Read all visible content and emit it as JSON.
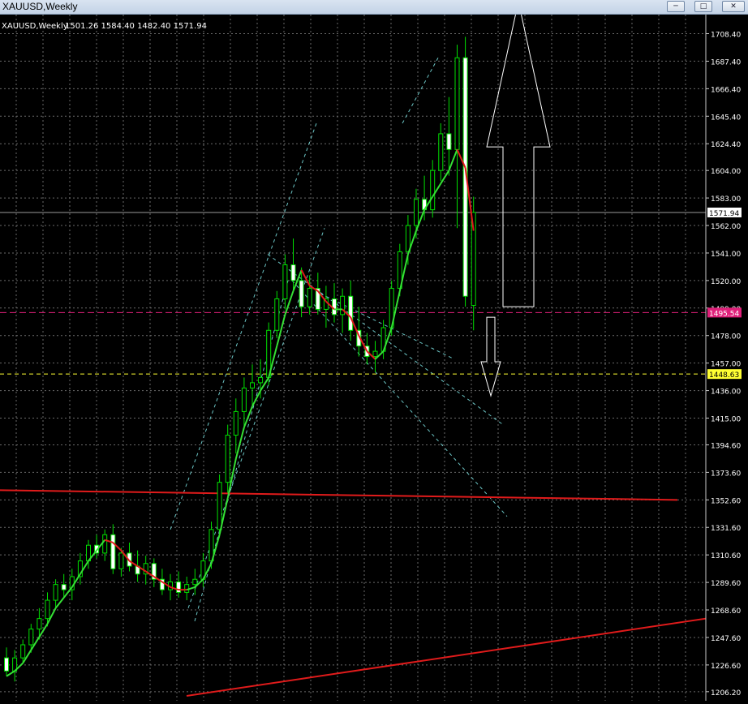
{
  "window": {
    "title": "XAUUSD,Weekly",
    "buttons": {
      "minimize": "min",
      "maximize": "max",
      "close": "close"
    }
  },
  "chart_header": {
    "symbol": "XAUUSD,Weekly",
    "ohlc": "1501.26 1584.40 1482.40 1571.94"
  },
  "colors": {
    "background": "#000000",
    "grid": "#6a6a6a",
    "bull": "#00e000",
    "ma_up": "#35e035",
    "ma_down": "#e01b1b",
    "trendline": "#e01b1b",
    "channel": "#6cc6c6",
    "resistance": "#e0207a",
    "support": "#ffff33"
  },
  "chart_data": {
    "type": "candlestick",
    "price_axis": [
      "1708.40",
      "1687.40",
      "1666.40",
      "1645.40",
      "1624.40",
      "1604.00",
      "1583.00",
      "1562.00",
      "1541.00",
      "1520.00",
      "1499.00",
      "1478.00",
      "1457.00",
      "1436.00",
      "1415.00",
      "1394.60",
      "1373.60",
      "1352.60",
      "1331.60",
      "1310.60",
      "1289.60",
      "1268.60",
      "1247.60",
      "1226.60",
      "1206.20"
    ],
    "ylim": [
      1203,
      1718
    ],
    "current_price_label": "1571.94",
    "resistance_label": "1495.54",
    "support_label": "1448.63",
    "candles": [
      [
        1232,
        1240,
        1218,
        1222
      ],
      [
        1222,
        1238,
        1214,
        1232
      ],
      [
        1232,
        1246,
        1228,
        1242
      ],
      [
        1242,
        1258,
        1236,
        1254
      ],
      [
        1254,
        1270,
        1246,
        1262
      ],
      [
        1262,
        1282,
        1256,
        1276
      ],
      [
        1276,
        1292,
        1270,
        1288
      ],
      [
        1288,
        1296,
        1278,
        1284
      ],
      [
        1284,
        1300,
        1276,
        1294
      ],
      [
        1294,
        1312,
        1288,
        1306
      ],
      [
        1306,
        1322,
        1300,
        1318
      ],
      [
        1318,
        1326,
        1308,
        1312
      ],
      [
        1312,
        1330,
        1306,
        1326
      ],
      [
        1326,
        1334,
        1296,
        1300
      ],
      [
        1300,
        1316,
        1294,
        1312
      ],
      [
        1312,
        1320,
        1298,
        1302
      ],
      [
        1302,
        1314,
        1290,
        1296
      ],
      [
        1296,
        1310,
        1288,
        1304
      ],
      [
        1304,
        1308,
        1286,
        1292
      ],
      [
        1292,
        1300,
        1280,
        1284
      ],
      [
        1284,
        1296,
        1276,
        1290
      ],
      [
        1290,
        1298,
        1278,
        1282
      ],
      [
        1282,
        1294,
        1276,
        1288
      ],
      [
        1288,
        1300,
        1280,
        1292
      ],
      [
        1292,
        1312,
        1286,
        1306
      ],
      [
        1306,
        1336,
        1300,
        1330
      ],
      [
        1330,
        1372,
        1324,
        1366
      ],
      [
        1366,
        1410,
        1358,
        1402
      ],
      [
        1402,
        1430,
        1388,
        1420
      ],
      [
        1420,
        1446,
        1408,
        1438
      ],
      [
        1438,
        1456,
        1424,
        1442
      ],
      [
        1442,
        1460,
        1430,
        1446
      ],
      [
        1446,
        1488,
        1440,
        1482
      ],
      [
        1482,
        1512,
        1476,
        1506
      ],
      [
        1506,
        1540,
        1498,
        1532
      ],
      [
        1532,
        1552,
        1512,
        1520
      ],
      [
        1520,
        1530,
        1492,
        1500
      ],
      [
        1500,
        1524,
        1494,
        1514
      ],
      [
        1514,
        1526,
        1494,
        1498
      ],
      [
        1498,
        1516,
        1484,
        1506
      ],
      [
        1506,
        1518,
        1488,
        1494
      ],
      [
        1494,
        1514,
        1480,
        1508
      ],
      [
        1508,
        1520,
        1474,
        1482
      ],
      [
        1482,
        1500,
        1462,
        1470
      ],
      [
        1470,
        1480,
        1456,
        1462
      ],
      [
        1462,
        1474,
        1450,
        1466
      ],
      [
        1466,
        1490,
        1460,
        1484
      ],
      [
        1484,
        1520,
        1478,
        1514
      ],
      [
        1514,
        1548,
        1508,
        1542
      ],
      [
        1542,
        1570,
        1532,
        1562
      ],
      [
        1562,
        1590,
        1552,
        1582
      ],
      [
        1582,
        1600,
        1566,
        1574
      ],
      [
        1574,
        1612,
        1568,
        1604
      ],
      [
        1604,
        1640,
        1596,
        1632
      ],
      [
        1632,
        1660,
        1600,
        1620
      ],
      [
        1620,
        1700,
        1560,
        1690
      ],
      [
        1690,
        1706,
        1500,
        1508
      ],
      [
        1501,
        1584,
        1482,
        1572
      ]
    ],
    "ma_points": [
      [
        1218,
        "u"
      ],
      [
        1222,
        "u"
      ],
      [
        1228,
        "u"
      ],
      [
        1238,
        "u"
      ],
      [
        1248,
        "u"
      ],
      [
        1258,
        "u"
      ],
      [
        1270,
        "u"
      ],
      [
        1278,
        "u"
      ],
      [
        1286,
        "u"
      ],
      [
        1296,
        "u"
      ],
      [
        1306,
        "u"
      ],
      [
        1314,
        "u"
      ],
      [
        1322,
        "u"
      ],
      [
        1320,
        "d"
      ],
      [
        1314,
        "d"
      ],
      [
        1306,
        "d"
      ],
      [
        1302,
        "d"
      ],
      [
        1298,
        "d"
      ],
      [
        1294,
        "d"
      ],
      [
        1290,
        "d"
      ],
      [
        1286,
        "d"
      ],
      [
        1284,
        "d"
      ],
      [
        1284,
        "d"
      ],
      [
        1286,
        "u"
      ],
      [
        1292,
        "u"
      ],
      [
        1304,
        "u"
      ],
      [
        1326,
        "u"
      ],
      [
        1354,
        "u"
      ],
      [
        1384,
        "u"
      ],
      [
        1408,
        "u"
      ],
      [
        1424,
        "u"
      ],
      [
        1436,
        "u"
      ],
      [
        1446,
        "u"
      ],
      [
        1470,
        "u"
      ],
      [
        1494,
        "u"
      ],
      [
        1512,
        "u"
      ],
      [
        1528,
        "u"
      ],
      [
        1516,
        "d"
      ],
      [
        1512,
        "d"
      ],
      [
        1504,
        "d"
      ],
      [
        1498,
        "d"
      ],
      [
        1498,
        "u"
      ],
      [
        1492,
        "d"
      ],
      [
        1478,
        "d"
      ],
      [
        1466,
        "d"
      ],
      [
        1460,
        "d"
      ],
      [
        1466,
        "u"
      ],
      [
        1484,
        "u"
      ],
      [
        1512,
        "u"
      ],
      [
        1540,
        "u"
      ],
      [
        1558,
        "u"
      ],
      [
        1574,
        "u"
      ],
      [
        1584,
        "u"
      ],
      [
        1594,
        "u"
      ],
      [
        1604,
        "u"
      ],
      [
        1620,
        "u"
      ],
      [
        1606,
        "d"
      ],
      [
        1558,
        "d"
      ]
    ]
  }
}
